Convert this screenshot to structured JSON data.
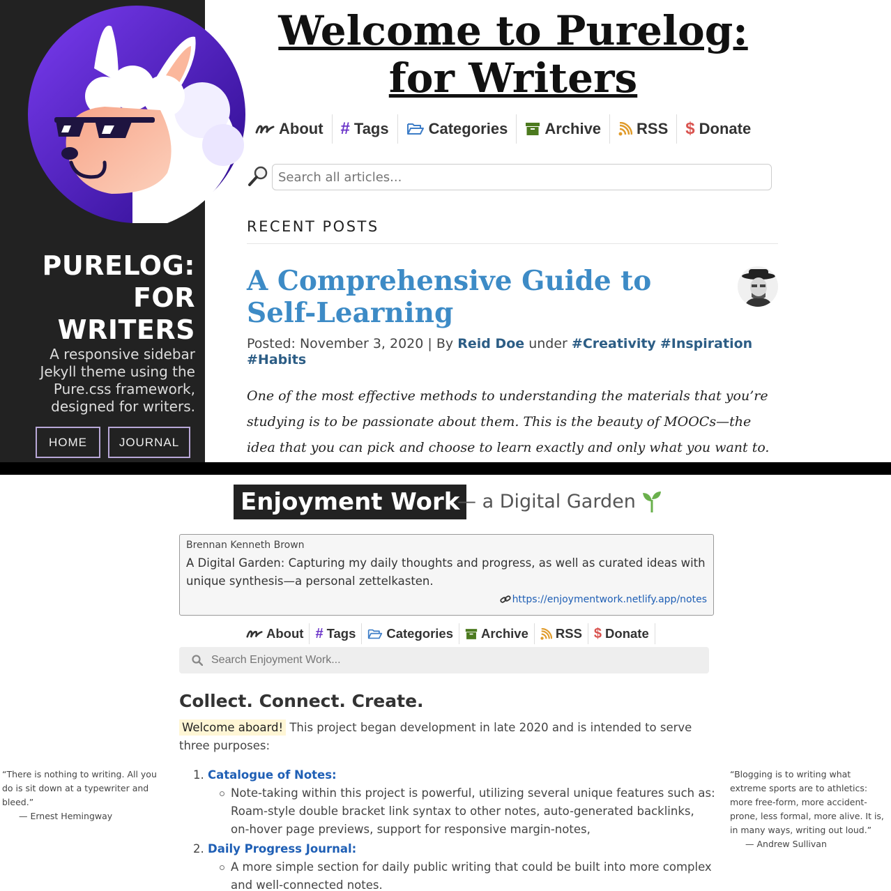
{
  "purelog": {
    "sidebar": {
      "brand": "PURELOG: FOR WRITERS",
      "description": "A responsive sidebar Jekyll theme using the Pure.css framework, designed for writers.",
      "buttons": [
        "HOME",
        "JOURNAL"
      ],
      "logo_icon": "llama-with-sunglasses-logo"
    },
    "title": "Welcome to Purelog: for Writers",
    "nav": [
      {
        "label": "About",
        "icon": "signature-icon"
      },
      {
        "label": "Tags",
        "icon": "hashtag-icon"
      },
      {
        "label": "Categories",
        "icon": "folder-open-icon"
      },
      {
        "label": "Archive",
        "icon": "archive-box-icon"
      },
      {
        "label": "RSS",
        "icon": "rss-icon"
      },
      {
        "label": "Donate",
        "icon": "dollar-icon"
      }
    ],
    "search": {
      "placeholder": "Search all articles..."
    },
    "recent_heading": "RECENT POSTS",
    "post": {
      "title": "A Comprehensive Guide to Self-Learning",
      "posted_label": "Posted: November 3, 2020",
      "separator": "|",
      "by_label": "By",
      "author": "Reid Doe",
      "under_label": "under",
      "tags": [
        "#Creativity",
        "#Inspiration",
        "#Habits"
      ],
      "excerpt": "One of the most effective methods to understanding the materials that you’re studying is to be passionate about them. This is the beauty of MOOCs—the idea that you can pick and choose to learn exactly and only what you want to. Don’t jump into"
    },
    "colors": {
      "sidebar_bg": "#222222",
      "link_blue": "#3d8bc6",
      "button_border": "#b9a8d8"
    }
  },
  "enjoyment": {
    "site_title": "Enjoyment Work",
    "site_subtitle": "— a Digital Garden",
    "info": {
      "author": "Brennan Kenneth Brown",
      "description": "A Digital Garden: Capturing my daily thoughts and progress, as well as curated ideas with unique synthesis—a personal zettelkasten.",
      "link": "https://enjoymentwork.netlify.app/notes"
    },
    "nav": [
      {
        "label": "About",
        "icon": "signature-icon"
      },
      {
        "label": "Tags",
        "icon": "hashtag-icon"
      },
      {
        "label": "Categories",
        "icon": "folder-open-icon"
      },
      {
        "label": "Archive",
        "icon": "archive-box-icon"
      },
      {
        "label": "RSS",
        "icon": "rss-icon"
      },
      {
        "label": "Donate",
        "icon": "dollar-icon"
      }
    ],
    "search": {
      "placeholder": "Search Enjoyment Work..."
    },
    "heading": "Collect. Connect. Create.",
    "intro_highlight": "Welcome aboard!",
    "intro_text": "This project began development in late 2020 and is intended to serve three purposes:",
    "purposes": [
      {
        "num": "1.",
        "title": "Catalogue of Notes:",
        "detail": "Note-taking within this project is powerful, utilizing several unique features such as: Roam-style double bracket link syntax to other notes, auto-generated backlinks, on-hover page previews, support for responsive margin-notes,"
      },
      {
        "num": "2.",
        "title": "Daily Progress Journal:",
        "detail": "A more simple section for daily public writing that could be built into more complex and well-connected notes."
      }
    ],
    "quote_left": {
      "text": "“There is nothing to writing. All you do is sit down at a typewriter and bleed.”",
      "attribution": "— Ernest Hemingway"
    },
    "quote_right": {
      "text": "“Blogging is to writing what extreme sports are to athletics: more free-form, more accident-prone, less formal, more alive. It is, in many ways, writing out loud.”",
      "attribution": "— Andrew Sullivan"
    },
    "colors": {
      "title_bg": "#222222",
      "link_blue": "#1f5fb5",
      "highlight": "#fff6d5",
      "sprout": "#6ab04c"
    }
  }
}
